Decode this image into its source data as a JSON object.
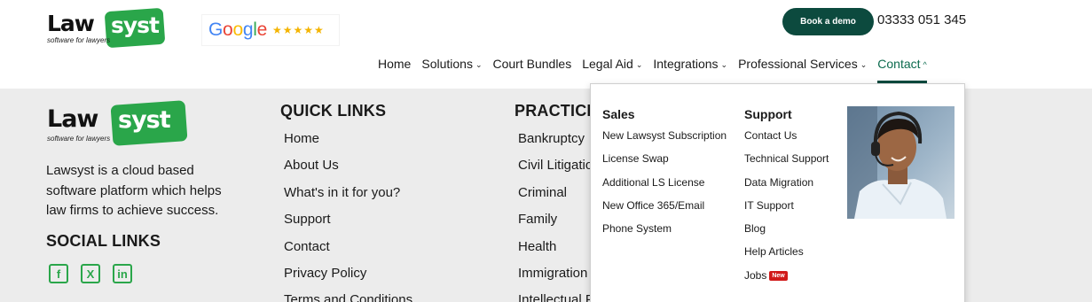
{
  "header": {
    "logo": {
      "word_dark": "Law",
      "word_light": "syst",
      "tagline": "software for lawyers"
    },
    "google_badge": {
      "letters": [
        "G",
        "o",
        "o",
        "g",
        "l",
        "e"
      ],
      "stars": "★★★★★"
    },
    "demo_button": "Book a demo",
    "phone": "03333 051 345",
    "nav": [
      {
        "label": "Home",
        "chevron": ""
      },
      {
        "label": "Solutions",
        "chevron": "⌄"
      },
      {
        "label": "Court Bundles",
        "chevron": ""
      },
      {
        "label": "Legal Aid",
        "chevron": "⌄"
      },
      {
        "label": "Integrations",
        "chevron": "⌄"
      },
      {
        "label": "Professional Services",
        "chevron": "⌄"
      },
      {
        "label": "Contact",
        "chevron": "^"
      }
    ]
  },
  "footer": {
    "logo": {
      "word_dark": "Law",
      "word_light": "syst",
      "tagline": "software for lawyers"
    },
    "about": "Lawsyst is a cloud based software platform which helps law firms to achieve success.",
    "social_title": "SOCIAL LINKS",
    "social_icons": [
      "f",
      "X",
      "in"
    ],
    "quick_links": {
      "title": "QUICK LINKS",
      "items": [
        "Home",
        "About Us",
        "What's in it for you?",
        "Support",
        "Contact",
        "Privacy Policy",
        "Terms and Conditions"
      ]
    },
    "practice_areas": {
      "title": "PRACTICE AREAS",
      "items": [
        "Bankruptcy",
        "Civil Litigation",
        "Criminal",
        "Family",
        "Health",
        "Immigration",
        "Intellectual Property"
      ]
    }
  },
  "dropdown": {
    "sales": {
      "title": "Sales",
      "items": [
        "New Lawsyst Subscription",
        "License Swap",
        "Additional LS License",
        "New Office 365/Email",
        "Phone System"
      ]
    },
    "support": {
      "title": "Support",
      "items": [
        "Contact Us",
        "Technical Support",
        "Data Migration",
        "IT Support",
        "Blog",
        "Help Articles",
        "Jobs"
      ],
      "new_badge": "New"
    }
  },
  "colors": {
    "brand_green": "#2aa64a",
    "dark_green": "#0c4a3e",
    "badge_red": "#d11a1a"
  }
}
